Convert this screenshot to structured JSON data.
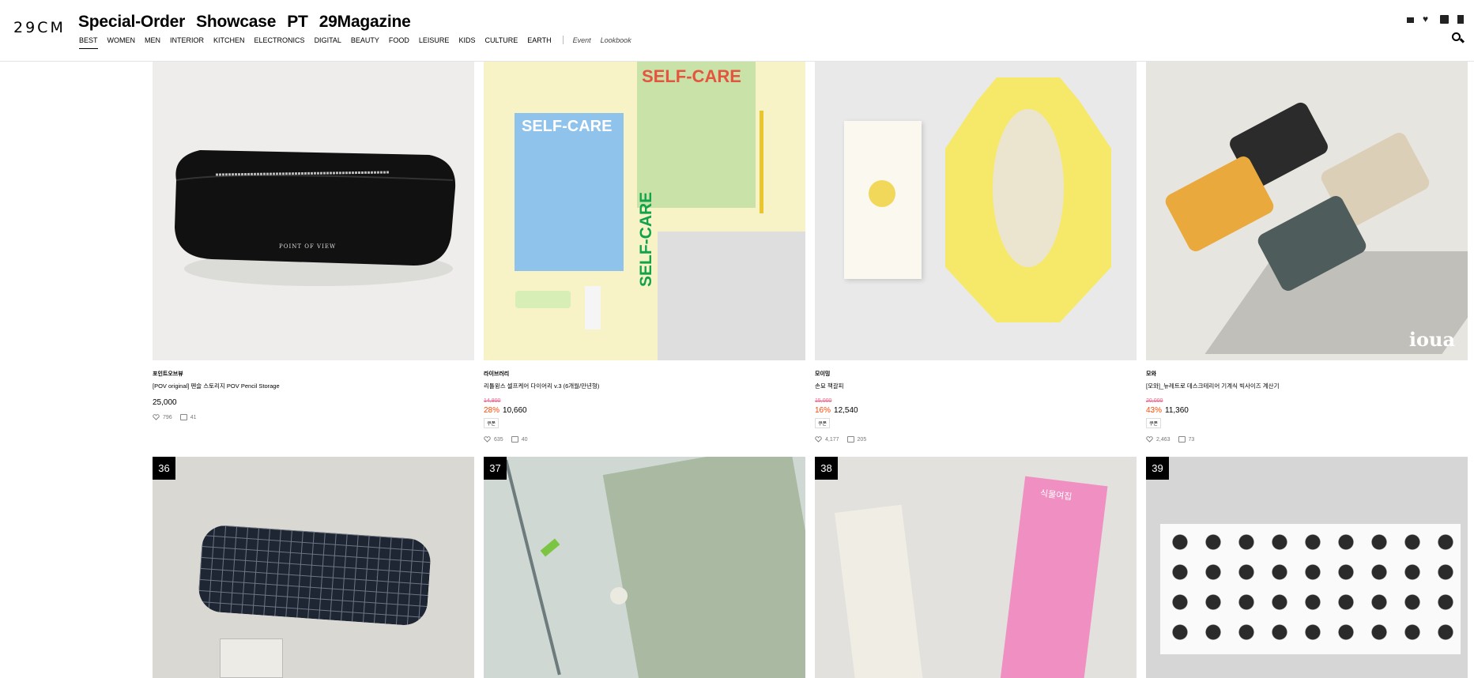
{
  "header": {
    "logo": "29CM",
    "top_nav": [
      "Special-Order",
      "Showcase",
      "PT",
      "29Magazine"
    ],
    "categories": [
      "BEST",
      "WOMEN",
      "MEN",
      "INTERIOR",
      "KITCHEN",
      "ELECTRONICS",
      "DIGITAL",
      "BEAUTY",
      "FOOD",
      "LEISURE",
      "KIDS",
      "CULTURE",
      "EARTH"
    ],
    "active_category": "BEST",
    "extra_links": [
      "Event",
      "Lookbook"
    ],
    "icons": [
      "cart-icon",
      "heart-icon",
      "bag-icon",
      "bookmark-icon",
      "search-icon"
    ]
  },
  "products_row1": [
    {
      "brand": "포인트오브뷰",
      "name": "[POV original] 펜슬 스토리지 POV Pencil Storage",
      "price": "25,000",
      "likes": "796",
      "reviews": "41",
      "image_text": "POINT OF VIEW"
    },
    {
      "brand": "라이브러리",
      "name": "리틀윙스 셀프케어 다이어리 v.3 (6개월/만년형)",
      "original_price": "14,800",
      "discount": "28%",
      "price": "10,660",
      "coupon": "쿠폰",
      "likes": "635",
      "reviews": "40",
      "image_text": "SELF-CARE"
    },
    {
      "brand": "모이밍",
      "name": "손묘 책갈피",
      "original_price": "15,000",
      "discount": "16%",
      "price": "12,540",
      "coupon": "쿠폰",
      "likes": "4,177",
      "reviews": "205"
    },
    {
      "brand": "모와",
      "name": "[모와]_뉴레트로 데스크테리어 기계식 빅사이즈 계산기",
      "original_price": "20,000",
      "discount": "43%",
      "price": "11,360",
      "coupon": "쿠폰",
      "likes": "2,463",
      "reviews": "73",
      "image_text": "ioua"
    }
  ],
  "products_row2": [
    {
      "rank": "36"
    },
    {
      "rank": "37"
    },
    {
      "rank": "38",
      "image_text": "식물여집"
    },
    {
      "rank": "39"
    }
  ],
  "colors": {
    "discount": "#ff4800",
    "accent_black": "#000000"
  }
}
